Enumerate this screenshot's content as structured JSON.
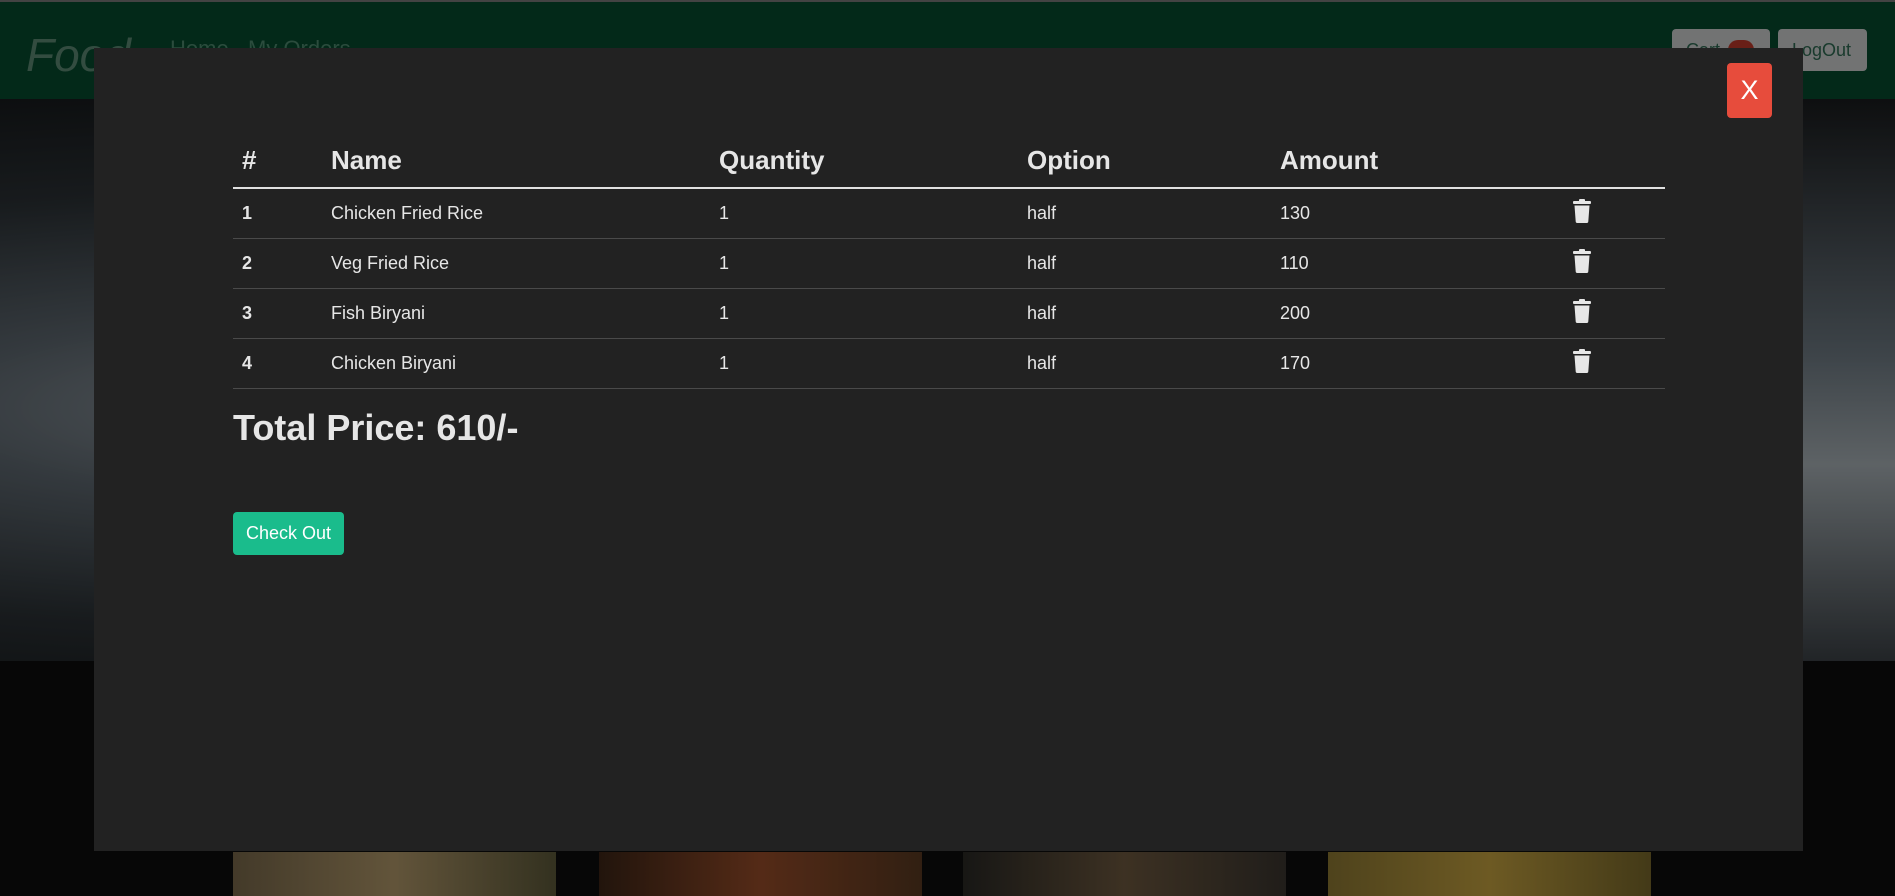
{
  "navbar": {
    "brand": "Food",
    "links": [
      "Home",
      "My Orders"
    ],
    "cart_label": "Cart",
    "logout_label": "LogOut"
  },
  "modal": {
    "close_label": "X",
    "table": {
      "headers": [
        "#",
        "Name",
        "Quantity",
        "Option",
        "Amount"
      ],
      "rows": [
        {
          "index": "1",
          "name": "Chicken Fried Rice",
          "quantity": "1",
          "option": "half",
          "amount": "130"
        },
        {
          "index": "2",
          "name": "Veg Fried Rice",
          "quantity": "1",
          "option": "half",
          "amount": "110"
        },
        {
          "index": "3",
          "name": "Fish Biryani",
          "quantity": "1",
          "option": "half",
          "amount": "200"
        },
        {
          "index": "4",
          "name": "Chicken Biryani",
          "quantity": "1",
          "option": "half",
          "amount": "170"
        }
      ]
    },
    "total_text": "Total Price: 610/-",
    "checkout_label": "Check Out"
  },
  "colors": {
    "navbar_bg": "#064c2f",
    "modal_bg": "#222222",
    "close_button": "#e74c3c",
    "checkout_button": "#1abc8c"
  },
  "icons": {
    "delete": "trash-icon"
  }
}
